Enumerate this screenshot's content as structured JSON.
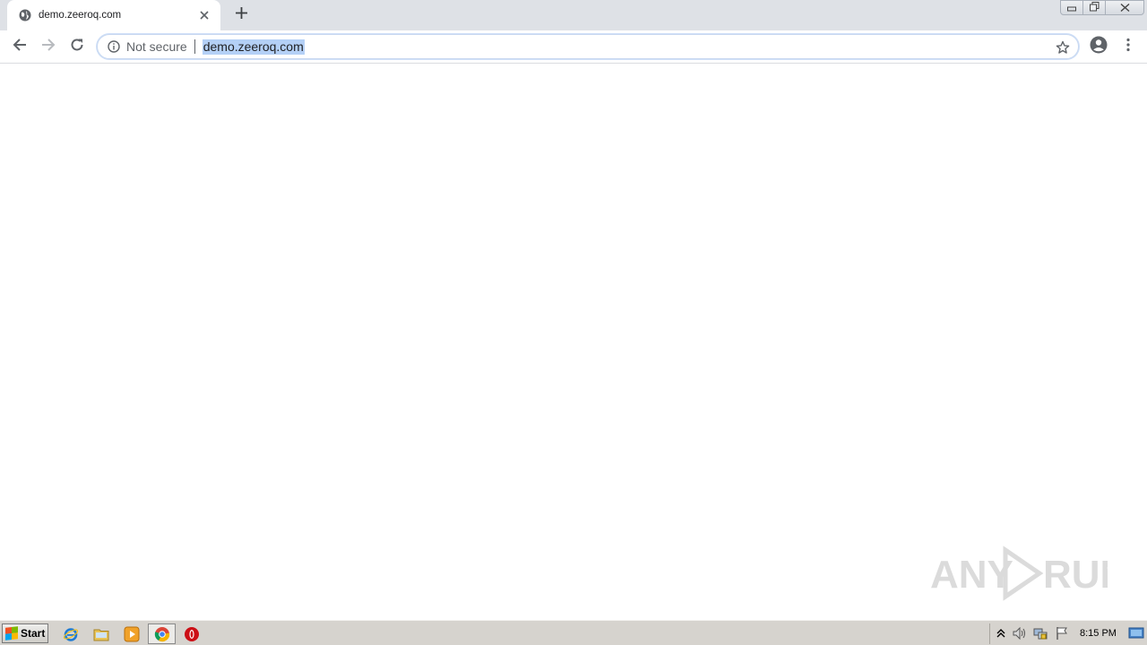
{
  "browser": {
    "tab": {
      "title": "demo.zeeroq.com",
      "favicon": "globe-icon"
    },
    "new_tab_icon": "plus-icon",
    "omnibox": {
      "security_label": "Not secure",
      "security_icon": "info-icon",
      "url": "demo.zeeroq.com",
      "url_selected": true
    },
    "nav": {
      "back_icon": "arrow-left-icon",
      "forward_icon": "arrow-right-icon",
      "reload_icon": "reload-icon"
    },
    "profile_icon": "account-circle-icon",
    "menu_icon": "kebab-menu-icon",
    "bookmark_icon": "star-icon"
  },
  "page": {
    "watermark": "ANY RUN"
  },
  "taskbar": {
    "start_label": "Start",
    "apps": [
      "internet-explorer-icon",
      "file-explorer-icon",
      "media-player-icon",
      "chrome-icon",
      "opera-icon"
    ],
    "clock": "8:15 PM"
  },
  "colors": {
    "tabstrip": "#dee1e6",
    "url_selection": "#b4d0f6",
    "taskbar": "#d6d3ce"
  }
}
